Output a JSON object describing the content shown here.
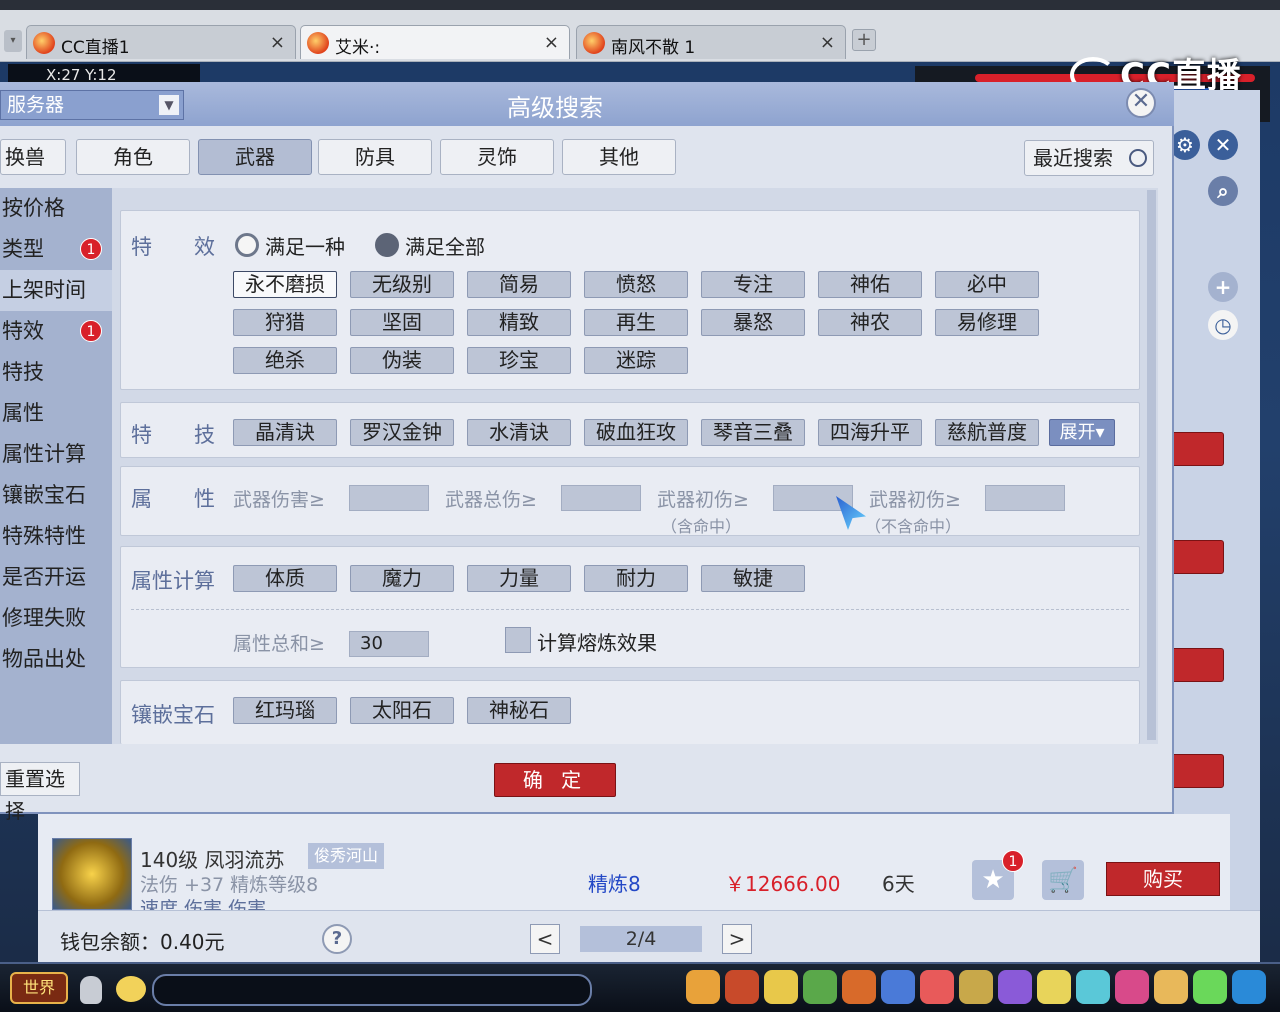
{
  "browser": {
    "tabs": [
      {
        "label": "CC直播1"
      },
      {
        "label": "艾米·:"
      },
      {
        "label": "南风不散 1"
      }
    ],
    "close_glyph": "×",
    "add_glyph": "+"
  },
  "game": {
    "coords": "X:27 Y:12",
    "watermark": "CC直播"
  },
  "dialog": {
    "title": "高级搜索",
    "close_glyph": "✕",
    "server_select": "服务器",
    "categories": [
      "换兽",
      "角色",
      "武器",
      "防具",
      "灵饰",
      "其他"
    ],
    "selected_category": "武器",
    "recent_search": "最近搜索",
    "sidebar": [
      {
        "label": "按价格"
      },
      {
        "label": "类型",
        "badge": "1"
      },
      {
        "label": "上架时间"
      },
      {
        "label": "特效",
        "badge": "1"
      },
      {
        "label": "特技"
      },
      {
        "label": "属性"
      },
      {
        "label": "属性计算"
      },
      {
        "label": "镶嵌宝石"
      },
      {
        "label": "特殊特性"
      },
      {
        "label": "是否开运"
      },
      {
        "label": "修理失败"
      },
      {
        "label": "物品出处"
      }
    ],
    "effects": {
      "label": "特　　效",
      "radio_any": "满足一种",
      "radio_all": "满足全部",
      "chips": [
        "永不磨损",
        "无级别",
        "简易",
        "愤怒",
        "专注",
        "神佑",
        "必中",
        "狩猎",
        "坚固",
        "精致",
        "再生",
        "暴怒",
        "神农",
        "易修理",
        "绝杀",
        "伪装",
        "珍宝",
        "迷踪"
      ]
    },
    "skills": {
      "label": "特　　技",
      "chips": [
        "晶清诀",
        "罗汉金钟",
        "水清诀",
        "破血狂攻",
        "琴音三叠",
        "四海升平",
        "慈航普度"
      ],
      "expand": "展开▾"
    },
    "attributes": {
      "label": "属　　性",
      "fields": [
        {
          "label": "武器伤害≥",
          "note": ""
        },
        {
          "label": "武器总伤≥",
          "note": ""
        },
        {
          "label": "武器初伤≥",
          "note": "（含命中）"
        },
        {
          "label": "武器初伤≥",
          "note": "（不含命中）"
        }
      ]
    },
    "attr_calc": {
      "label": "属性计算",
      "chips": [
        "体质",
        "魔力",
        "力量",
        "耐力",
        "敏捷"
      ],
      "sum_label": "属性总和≥",
      "sum_value": "30",
      "smelt_label": "计算熔炼效果"
    },
    "gems": {
      "label": "镶嵌宝石",
      "chips": [
        "红玛瑙",
        "太阳石",
        "神秘石"
      ]
    },
    "reset": "重置选择",
    "confirm": "确 定"
  },
  "listing": {
    "name": "140级 凤羽流苏",
    "server_tag": "俊秀河山",
    "stats": "法伤 +37 精炼等级8",
    "stats2": "速度 伤害 伤害",
    "refine": "精炼8",
    "price": "￥12666.00",
    "days": "6天",
    "fav_badge": "1",
    "buy": "购买"
  },
  "footer": {
    "wallet": "钱包余额：0.40元",
    "help": "?",
    "page": "2/4",
    "prev": "<",
    "next": ">"
  },
  "gamebar": {
    "channel": "世界"
  },
  "colors": {
    "accent_red": "#c0282b",
    "dialog_bg": "#dfe4ee",
    "label_blue": "#5d6f9b"
  }
}
